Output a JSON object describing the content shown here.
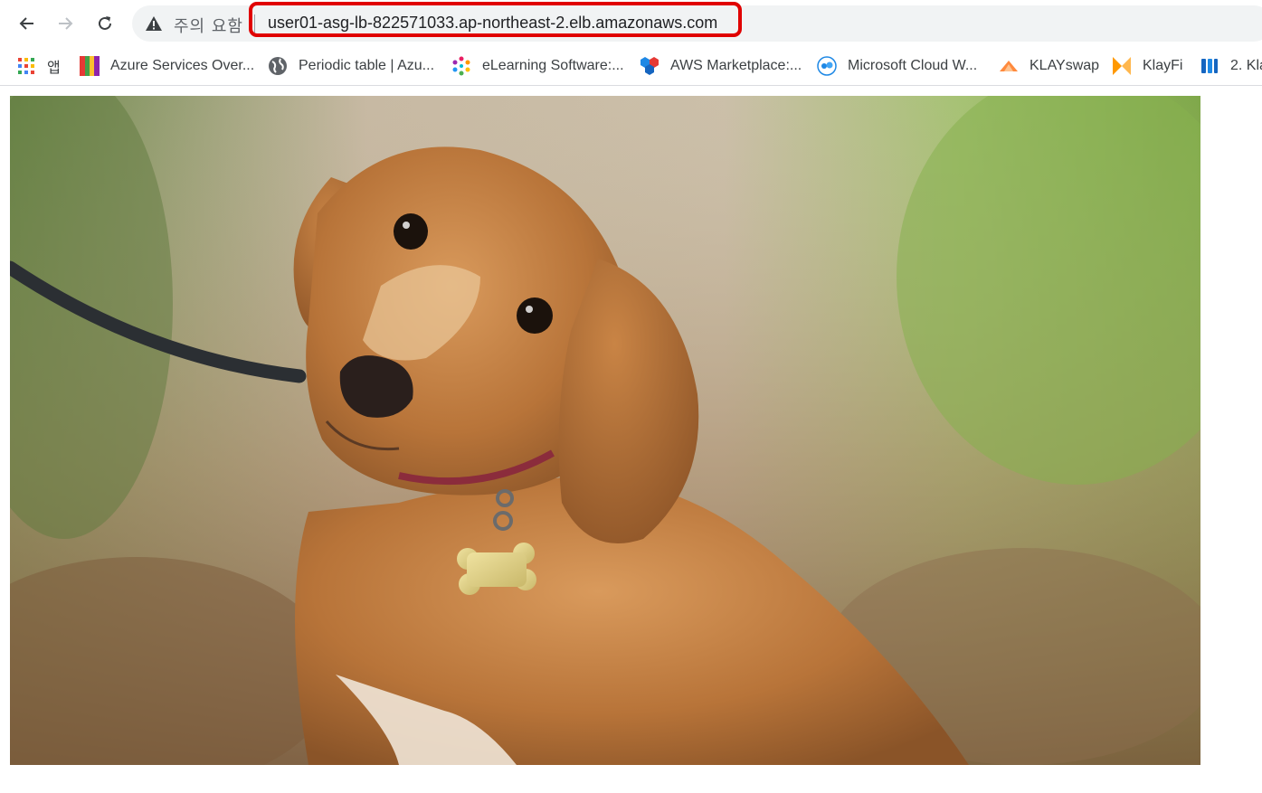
{
  "toolbar": {
    "security_label": "주의 요함",
    "url": "user01-asg-lb-822571033.ap-northeast-2.elb.amazonaws.com",
    "highlight_color": "#e00000"
  },
  "bookmarks": [
    {
      "label": "앱",
      "icon": "apps-grid-icon"
    },
    {
      "label": "Azure Services Over...",
      "icon": "azure-services-icon"
    },
    {
      "label": "Periodic table | Azu...",
      "icon": "globe-icon"
    },
    {
      "label": "eLearning Software:...",
      "icon": "elearning-icon"
    },
    {
      "label": "AWS Marketplace:...",
      "icon": "aws-marketplace-icon"
    },
    {
      "label": "Microsoft Cloud W...",
      "icon": "microsoft-cloud-icon"
    },
    {
      "label": "KLAYswap",
      "icon": "klayswap-icon"
    },
    {
      "label": "KlayFi",
      "icon": "klayfi-icon"
    },
    {
      "label": "2. Kla",
      "icon": "bookmark-book-icon"
    }
  ],
  "content": {
    "image_subject": "dog-photo"
  }
}
